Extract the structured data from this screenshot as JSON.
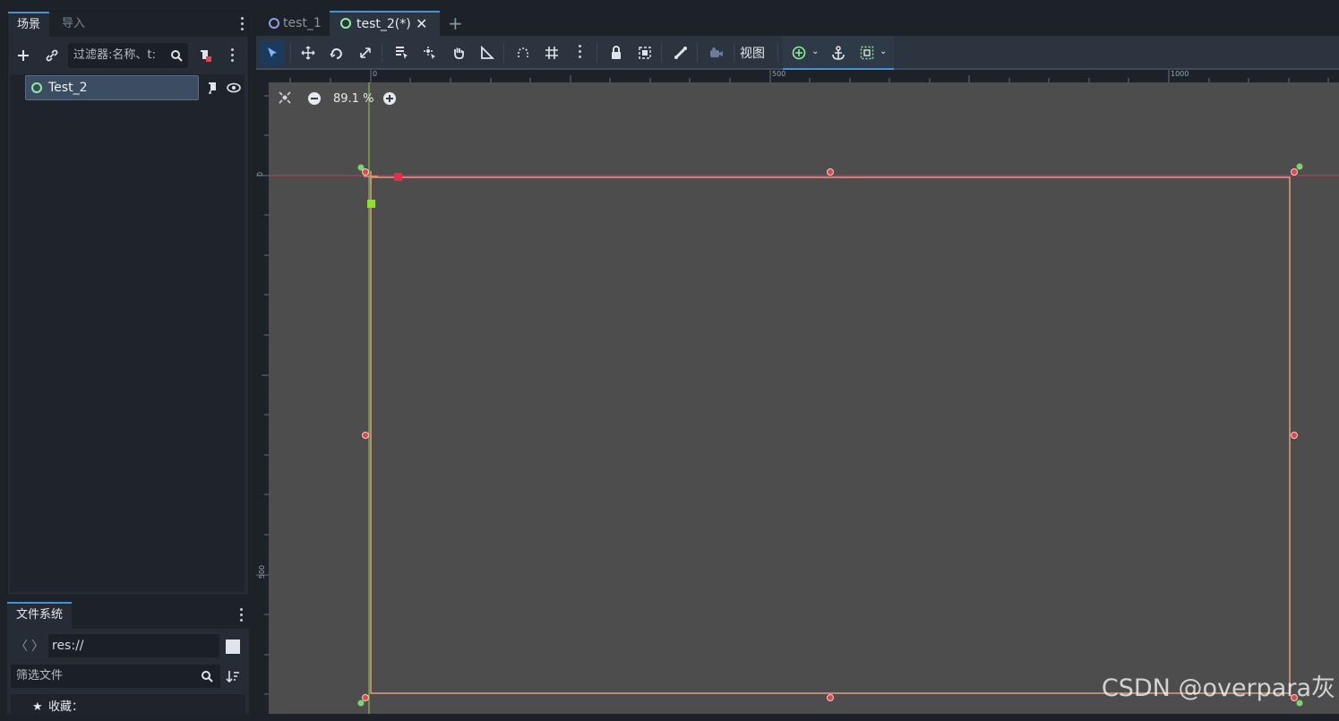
{
  "scene_dock": {
    "tabs": [
      {
        "label": "场景",
        "active": true
      },
      {
        "label": "导入",
        "active": false
      }
    ],
    "filter_placeholder": "过滤器:名称、t:",
    "tree": [
      {
        "label": "Test_2",
        "selected": true
      }
    ]
  },
  "filesystem_dock": {
    "tab_label": "文件系统",
    "path": "res://",
    "filter_placeholder": "筛选文件",
    "favorites_label": "收藏："
  },
  "scene_tabs": [
    {
      "label": "test_1",
      "active": false
    },
    {
      "label": "test_2(*)",
      "active": true
    }
  ],
  "toolbar": {
    "view_label": "视图"
  },
  "rulers": {
    "top_ticks": [
      "0",
      "500",
      "1000"
    ],
    "left_ticks": [
      "0",
      "500"
    ]
  },
  "viewport": {
    "zoom_level": "89.1 %"
  },
  "colors": {
    "accent": "#4a90d9",
    "node_ring": "#8eef97",
    "frame": "#e0967a",
    "handle": "#e0464e",
    "anchor_green": "#7fd36a"
  },
  "watermark": "CSDN @overpara灰"
}
